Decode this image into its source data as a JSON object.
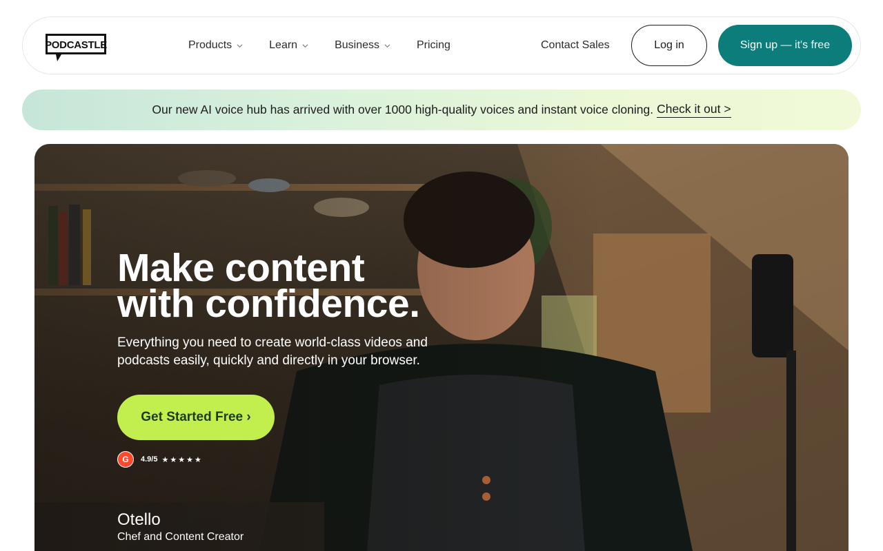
{
  "brand": {
    "logo_text": "PODCASTLE"
  },
  "nav": {
    "items": [
      {
        "label": "Products",
        "has_dropdown": true
      },
      {
        "label": "Learn",
        "has_dropdown": true
      },
      {
        "label": "Business",
        "has_dropdown": true
      },
      {
        "label": "Pricing",
        "has_dropdown": false
      }
    ],
    "contact_sales": "Contact Sales",
    "login": "Log in",
    "signup": "Sign up — it's free"
  },
  "banner": {
    "text": "Our new AI voice hub has arrived with over 1000 high-quality voices and instant voice cloning.",
    "link": "Check it out >"
  },
  "hero": {
    "title_line1": "Make content",
    "title_line2": "with confidence.",
    "subtitle": "Everything you need to create world-class videos and podcasts easily, quickly and directly in your browser.",
    "cta": "Get Started Free ›",
    "rating": {
      "badge": "G",
      "value": "4.9/5",
      "stars": 5
    },
    "person_name": "Otello",
    "person_role": "Chef and Content Creator"
  },
  "colors": {
    "accent_teal": "#0c7d7b",
    "cta_green": "#c2ef4e",
    "g2_red": "#ff492c"
  }
}
